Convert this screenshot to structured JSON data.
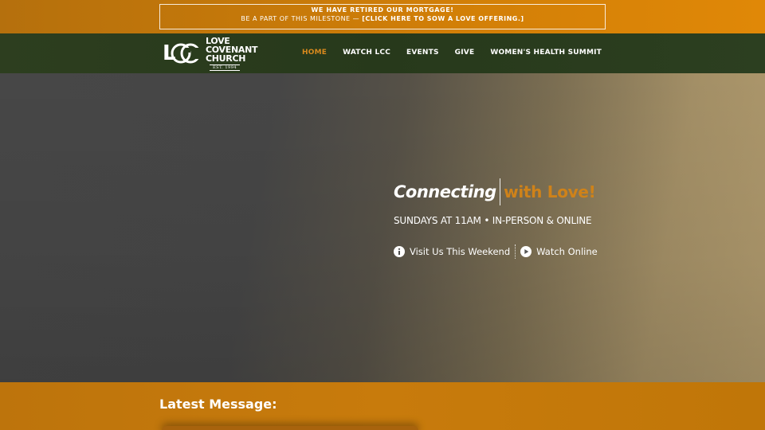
{
  "announcement": {
    "line1": "WE HAVE RETIRED OUR MORTGAGE!",
    "line2_prefix": "BE A PART OF THIS MILESTONE — ",
    "line2_cta": "[CLICK HERE TO SOW A LOVE OFFERING.]"
  },
  "brand": {
    "monogram": "LCC",
    "name_line1": "LOVE",
    "name_line2": "COVENANT",
    "name_line3": "CHURCH",
    "est": "EST. 1994"
  },
  "nav": {
    "items": [
      {
        "label": "HOME",
        "active": true
      },
      {
        "label": "WATCH LCC",
        "active": false
      },
      {
        "label": "EVENTS",
        "active": false
      },
      {
        "label": "GIVE",
        "active": false
      },
      {
        "label": "WOMEN'S HEALTH SUMMIT",
        "active": false
      }
    ]
  },
  "hero": {
    "headline_white": "Connecting",
    "headline_accent": "with Love!",
    "subtitle": "SUNDAYS AT 11AM • IN-PERSON & ONLINE",
    "link_visit": "Visit Us This Weekend",
    "link_watch": "Watch Online",
    "icons": [
      "info-icon",
      "play-icon"
    ]
  },
  "latest": {
    "heading": "Latest Message:"
  },
  "colors": {
    "accent": "#cf8219",
    "nav_bg": "#2a3c1d",
    "banner_bg": "#d27f07"
  }
}
